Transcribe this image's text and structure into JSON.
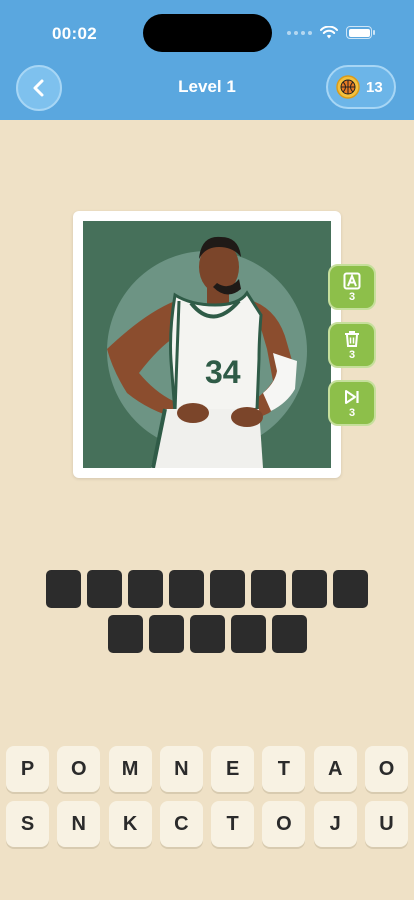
{
  "status_bar": {
    "time": "00:02"
  },
  "header": {
    "title": "Level 1",
    "coins": "13"
  },
  "hints": [
    {
      "icon": "letter-a-icon",
      "count": "3"
    },
    {
      "icon": "trash-icon",
      "count": "3"
    },
    {
      "icon": "skip-icon",
      "count": "3"
    }
  ],
  "picture": {
    "jersey_number": "34"
  },
  "answer": {
    "word_lengths": [
      8,
      5
    ]
  },
  "keyboard": {
    "row1": [
      "P",
      "O",
      "M",
      "N",
      "E",
      "T",
      "A",
      "O"
    ],
    "row2": [
      "S",
      "N",
      "K",
      "C",
      "T",
      "O",
      "J",
      "U"
    ]
  },
  "colors": {
    "header": "#5aa7df",
    "background": "#efe1c6",
    "hint_green": "#8dbf4a",
    "slot": "#2c2c2c",
    "key": "#f8f2e3"
  }
}
